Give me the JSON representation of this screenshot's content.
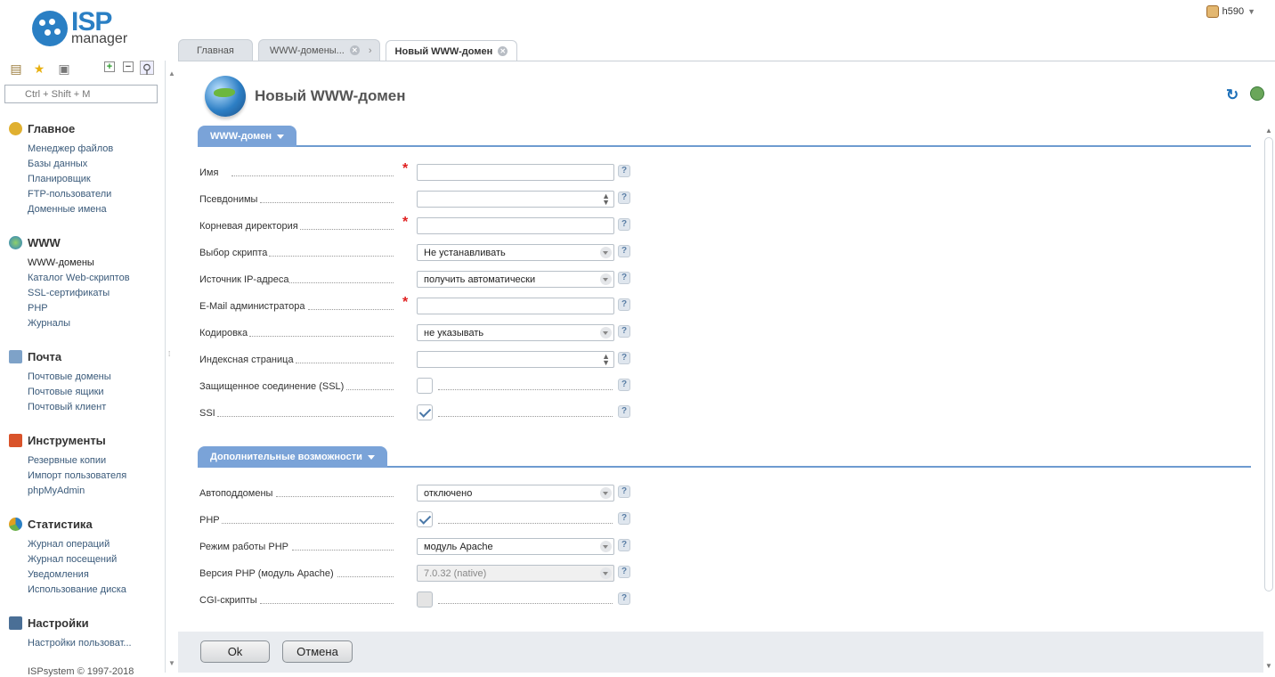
{
  "brand": {
    "logo_top": "ISP",
    "logo_bottom": "manager"
  },
  "user": {
    "name": "h590"
  },
  "tabs": [
    {
      "label": "Главная"
    },
    {
      "label": "WWW-домены..."
    },
    {
      "label": "Новый WWW-домен"
    }
  ],
  "sidebar": {
    "search_placeholder": "Ctrl + Shift + M",
    "groups": [
      {
        "title": "Главное",
        "items": [
          "Менеджер файлов",
          "Базы данных",
          "Планировщик",
          "FTP-пользователи",
          "Доменные имена"
        ]
      },
      {
        "title": "WWW",
        "items": [
          "WWW-домены",
          "Каталог Web-скриптов",
          "SSL-сертификаты",
          "PHP",
          "Журналы"
        ]
      },
      {
        "title": "Почта",
        "items": [
          "Почтовые домены",
          "Почтовые ящики",
          "Почтовый клиент"
        ]
      },
      {
        "title": "Инструменты",
        "items": [
          "Резервные копии",
          "Импорт пользователя",
          "phpMyAdmin"
        ]
      },
      {
        "title": "Статистика",
        "items": [
          "Журнал операций",
          "Журнал посещений",
          "Уведомления",
          "Использование диска"
        ]
      },
      {
        "title": "Настройки",
        "items": [
          "Настройки пользоват..."
        ]
      }
    ],
    "copyright": "ISPsystem © 1997-2018"
  },
  "page": {
    "title": "Новый WWW-домен"
  },
  "section1": {
    "title": "WWW-домен",
    "fields": {
      "name": {
        "label": "Имя",
        "value": ""
      },
      "aliases": {
        "label": "Псевдонимы",
        "value": ""
      },
      "root": {
        "label": "Корневая директория",
        "value": ""
      },
      "script": {
        "label": "Выбор скрипта",
        "value": "Не устанавливать"
      },
      "ip": {
        "label": "Источник IP-адреса",
        "value": "получить автоматически"
      },
      "email": {
        "label": "E-Mail администратора",
        "value": ""
      },
      "charset": {
        "label": "Кодировка",
        "value": "не указывать"
      },
      "index": {
        "label": "Индексная страница",
        "value": ""
      },
      "ssl": {
        "label": "Защищенное соединение (SSL)",
        "checked": false
      },
      "ssi": {
        "label": "SSI",
        "checked": true
      }
    }
  },
  "section2": {
    "title": "Дополнительные возможности",
    "fields": {
      "autosub": {
        "label": "Автоподдомены",
        "value": "отключено"
      },
      "php": {
        "label": "PHP",
        "checked": true
      },
      "phpmode": {
        "label": "Режим работы PHP",
        "value": "модуль Apache"
      },
      "phpver": {
        "label": "Версия PHP (модуль Apache)",
        "value": "7.0.32 (native)"
      },
      "cgi": {
        "label": "CGI-скрипты",
        "checked": false
      }
    }
  },
  "required_mark": "*",
  "help_mark": "?",
  "buttons": {
    "ok": "Ok",
    "cancel": "Отмена"
  },
  "colors": {
    "accent": "#2a7fc4",
    "section_tab": "#7aa3d8",
    "required": "#e02020"
  }
}
